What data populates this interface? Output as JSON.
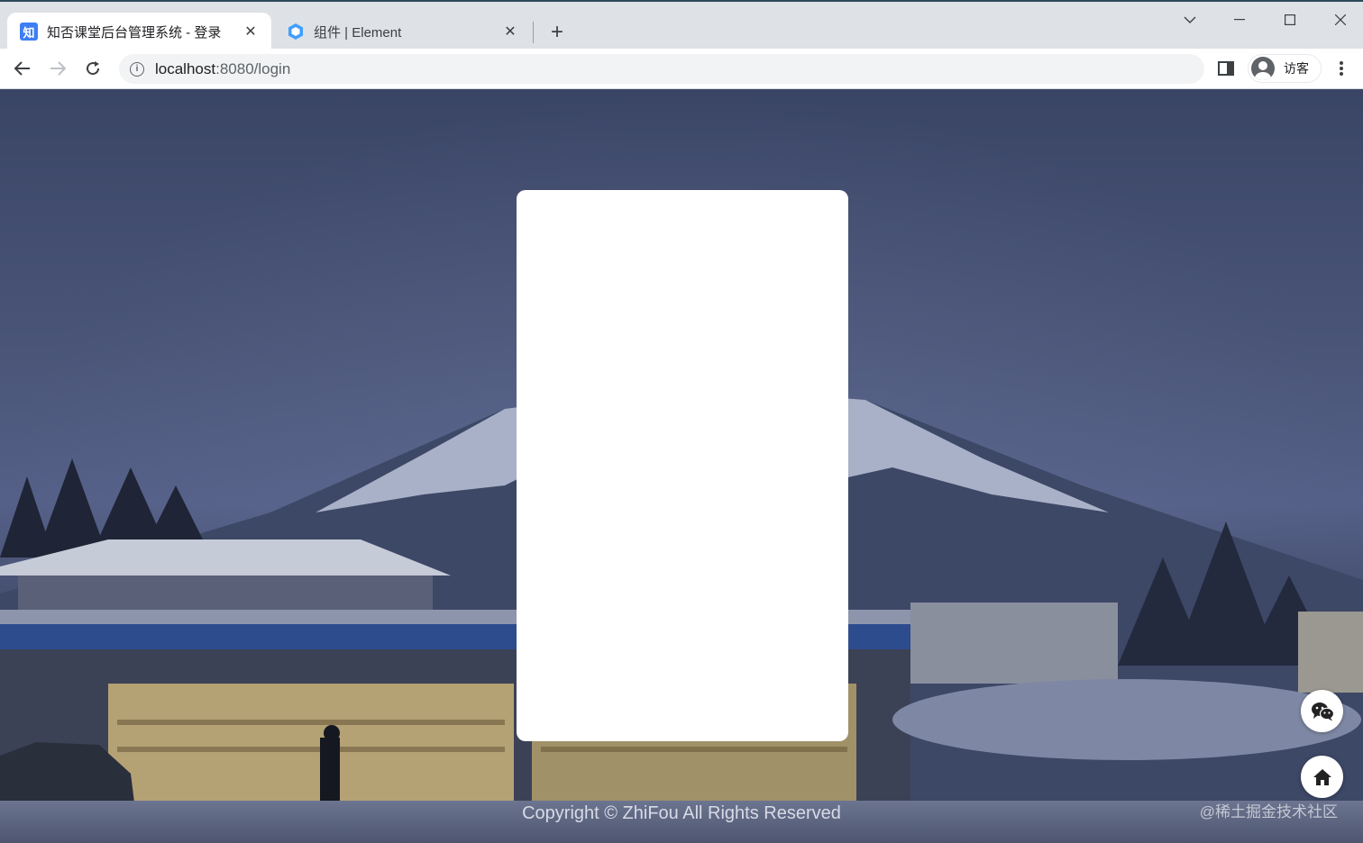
{
  "browser": {
    "tabs": [
      {
        "favicon": "知",
        "title": "知否课堂后台管理系统 - 登录",
        "active": true
      },
      {
        "favicon": "element-logo-icon",
        "title": "组件 | Element",
        "active": false
      }
    ],
    "new_tab_label": "+",
    "address": {
      "host": "localhost",
      "port_path": ":8080/login"
    },
    "profile_label": "访客"
  },
  "page": {
    "copyright": "Copyright © ZhiFou All Rights Reserved",
    "watermark": "@稀土掘金技术社区"
  },
  "colors": {
    "card_bg": "#ffffff",
    "chrome_bg": "#dee1e6",
    "accent": "#3d7ef5"
  }
}
